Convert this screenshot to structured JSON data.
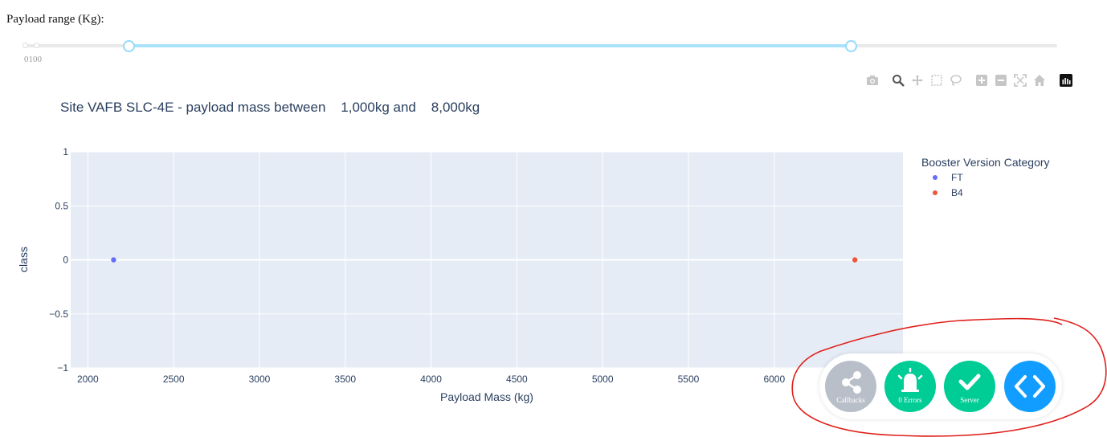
{
  "slider": {
    "label": "Payload range (Kg):",
    "min": 0,
    "max": 10000,
    "value": [
      1000,
      8000
    ],
    "marks": "0100"
  },
  "modebar": {
    "icons": [
      "camera-icon",
      "zoom-icon",
      "pan-icon",
      "box-select-icon",
      "lasso-icon",
      "zoom-in-icon",
      "zoom-out-icon",
      "autoscale-icon",
      "reset-axes-icon",
      "plotly-logo-icon"
    ]
  },
  "chart_data": {
    "type": "scatter",
    "title": "Site VAFB SLC-4E - payload mass between    1,000kg and    8,000kg",
    "xlabel": "Payload Mass (kg)",
    "ylabel": "class",
    "xlim": [
      1900,
      6750
    ],
    "ylim": [
      -1,
      1
    ],
    "xticks": [
      "2000",
      "2500",
      "3000",
      "3500",
      "4000",
      "4500",
      "5000",
      "5500",
      "6000"
    ],
    "yticks": [
      "1",
      "0.5",
      "0",
      "−0.5",
      "−1"
    ],
    "grid": true,
    "legend_title": "Booster Version Category",
    "legend_position": "right",
    "series": [
      {
        "name": "FT",
        "color": "#636efa",
        "points": [
          [
            2150,
            0
          ]
        ]
      },
      {
        "name": "B4",
        "color": "#ef553b",
        "points": [
          [
            6470,
            0
          ]
        ]
      }
    ]
  },
  "devtools": {
    "callbacks_label": "Callbacks",
    "errors_label": "0 Errors",
    "server_label": "Server",
    "colors": {
      "callbacks": "#b9bfc9",
      "errors": "#00cc96",
      "server": "#00cc96",
      "code": "#119dff"
    }
  },
  "annotation": {
    "color": "#e0201b"
  }
}
